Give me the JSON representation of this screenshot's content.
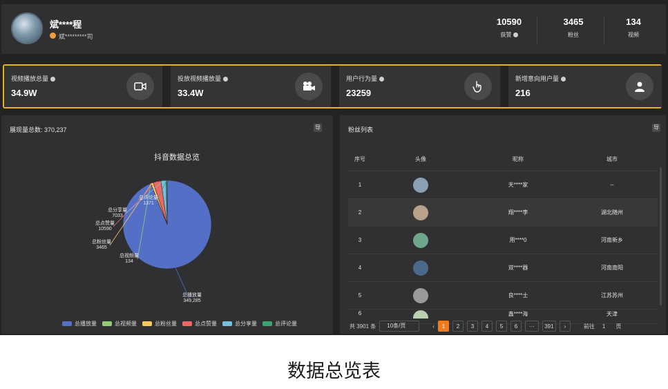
{
  "header": {
    "username": "斌****程",
    "subtitle": "斌*********司",
    "stats": [
      {
        "value": "10590",
        "label": "获赞"
      },
      {
        "value": "3465",
        "label": "粉丝"
      },
      {
        "value": "134",
        "label": "视频"
      }
    ]
  },
  "kpis": [
    {
      "title": "视频播放总量",
      "value": "34.9W",
      "icon": "video-icon"
    },
    {
      "title": "投放视频播放量",
      "value": "33.4W",
      "icon": "camera-icon"
    },
    {
      "title": "用户行为量",
      "value": "23259",
      "icon": "pointer-hand-icon"
    },
    {
      "title": "新增意向用户量",
      "value": "216",
      "icon": "person-icon"
    }
  ],
  "left_panel": {
    "title": "展现量总数: 370,237",
    "button": "导"
  },
  "chart_data": {
    "type": "pie",
    "title": "抖音数据总览",
    "categories": [
      "总播放量",
      "总视频量",
      "总粉丝量",
      "总点赞量",
      "总分享量",
      "总评论量"
    ],
    "values": [
      349285,
      134,
      3465,
      10590,
      7033,
      1371
    ],
    "colors": [
      "#5470c6",
      "#91cc75",
      "#fac858",
      "#ee6666",
      "#73c0de",
      "#3ba272"
    ],
    "slice_labels": [
      "总播放量\n349,285",
      "总视频量\n134",
      "总粉丝量\n3465",
      "总点赞量\n10590",
      "总分享量\n7033",
      "总评论量\n1371"
    ],
    "legend_position": "bottom"
  },
  "right_panel": {
    "title": "粉丝列表",
    "button": "导",
    "columns": [
      "序号",
      "头像",
      "昵称",
      "城市"
    ],
    "rows": [
      {
        "index": "1",
        "name": "天****家",
        "city": "--"
      },
      {
        "index": "2",
        "name": "翔****李",
        "city": "湖北随州"
      },
      {
        "index": "3",
        "name": "用****0",
        "city": "河南新乡"
      },
      {
        "index": "4",
        "name": "双****器",
        "city": "河南南阳"
      },
      {
        "index": "5",
        "name": "良****士",
        "city": "江苏苏州"
      },
      {
        "index": "6",
        "name": "鑫****海",
        "city": "天津"
      }
    ],
    "avatar_colors": [
      "#8aa0b4",
      "#b9a28a",
      "#6fa58c",
      "#4b6a8a",
      "#9a9a9a",
      "#b8d0b0"
    ],
    "pager": {
      "total": "共 3901 条",
      "page_size": "10条/页",
      "prev": "‹",
      "pages": [
        "1",
        "2",
        "3",
        "4",
        "5",
        "6",
        "···",
        "391"
      ],
      "next": "›",
      "goto_label": "前往",
      "goto_value": "1",
      "goto_suffix": "页"
    }
  },
  "caption": "数据总览表"
}
